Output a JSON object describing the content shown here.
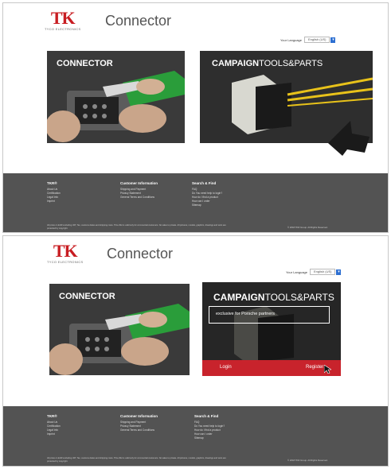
{
  "frames": [
    {
      "logo": {
        "mark": "TK",
        "sub": "TYCO ELECTRONICS"
      },
      "title": "Connector",
      "language": {
        "label": "Your Language",
        "selected": "English (US)"
      },
      "tile_connector": {
        "label": "CONNECTOR"
      },
      "tile_campaign": {
        "label_bold": "CAMPAIGN",
        "label_rest": "TOOLS&PARTS"
      },
      "footer": {
        "col1": {
          "heading": "TKR®",
          "items": [
            "About Us",
            "Certification",
            "Legal Info",
            "Imprint"
          ]
        },
        "col2": {
          "heading": "Customer Information",
          "items": [
            "Shipping and Payment",
            "Privacy Statement",
            "General Terms and Conditions"
          ]
        },
        "col3": {
          "heading": "Search & Find",
          "items": [
            "FAQ",
            "Do You need help to login?",
            "How do I find a product",
            "How can I order",
            "Sitemap"
          ]
        },
        "copyright": "All prices in EUR excluding VAT, Tax, customs duties and shipping costs. This offer is valid only for commercial customers. No sales to private. All pictures, models, graphics, drawings and texts are protected by copyright.",
        "rights": "© 2018 TKR Group. All Rights Reserved."
      }
    },
    {
      "logo": {
        "mark": "TK",
        "sub": "TYCO ELECTRONICS"
      },
      "title": "Connector",
      "language": {
        "label": "Your Language",
        "selected": "English (US)"
      },
      "tile_connector": {
        "label": "CONNECTOR"
      },
      "tile_campaign": {
        "label_bold": "CAMPAIGN",
        "label_rest": "TOOLS&PARTS",
        "exclusive": "exclusive for Porsche partners",
        "login": "Login",
        "register": "Register"
      },
      "footer": {
        "col1": {
          "heading": "TKR®",
          "items": [
            "About Us",
            "Certification",
            "Legal Info",
            "Imprint"
          ]
        },
        "col2": {
          "heading": "Customer Information",
          "items": [
            "Shipping and Payment",
            "Privacy Statement",
            "General Terms and Conditions"
          ]
        },
        "col3": {
          "heading": "Search & Find",
          "items": [
            "FAQ",
            "Do You need help to login?",
            "How do I find a product",
            "How can I order",
            "Sitemap"
          ]
        },
        "copyright": "All prices in EUR excluding VAT, Tax, customs duties and shipping costs. This offer is valid only for commercial customers. No sales to private. All pictures, models, graphics, drawings and texts are protected by copyright.",
        "rights": "© 2018 TKR Group. All Rights Reserved."
      }
    }
  ],
  "colors": {
    "brand_red": "#c81d22",
    "footer_bg": "#535353",
    "tile_bg": "#2b2b2b",
    "connector_green": "#2a9d3a",
    "wire_yellow": "#e8c21a"
  }
}
